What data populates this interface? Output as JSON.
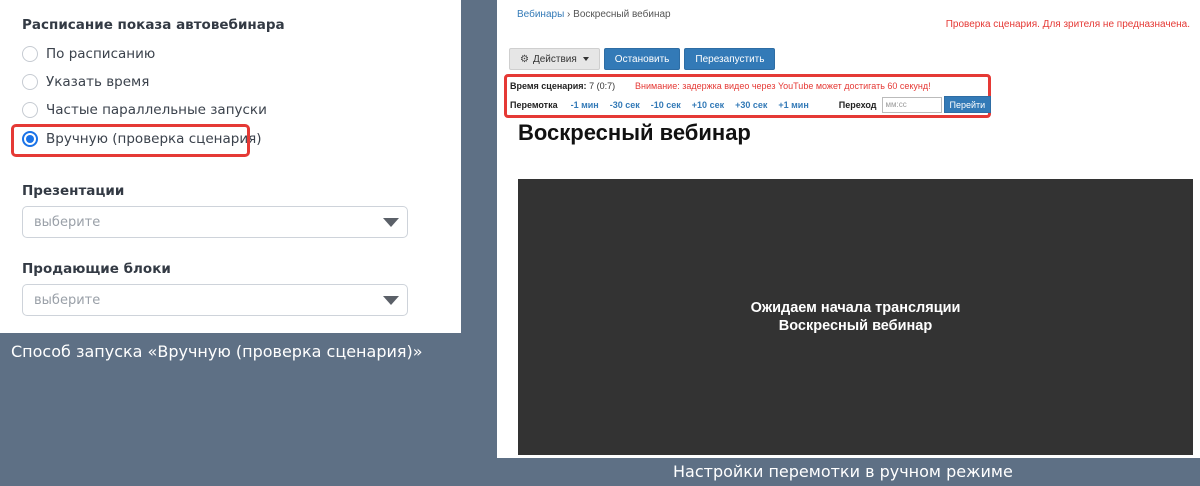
{
  "left": {
    "schedule_heading": "Расписание показа автовебинара",
    "radio_options": [
      {
        "label": "По расписанию",
        "checked": false
      },
      {
        "label": "Указать время",
        "checked": false
      },
      {
        "label": "Частые параллельные запуски",
        "checked": false
      },
      {
        "label": "Вручную (проверка сценария)",
        "checked": true
      }
    ],
    "presentations_heading": "Презентации",
    "presentations_placeholder": "выберите",
    "selling_blocks_heading": "Продающие блоки",
    "selling_blocks_placeholder": "выберите",
    "caption": "Способ запуска «Вручную (проверка сценария)»"
  },
  "right": {
    "breadcrumb": {
      "link": "Вебинары",
      "separator": "›",
      "current": "Воскресный вебинар"
    },
    "preview_note": "Проверка сценария. Для зрителя не предназначена.",
    "buttons": {
      "actions": "Действия",
      "stop": "Остановить",
      "restart": "Перезапустить"
    },
    "scenario_time_label": "Время сценария:",
    "scenario_time_value": "7 (0:7)",
    "youtube_warning": "Внимание: задержка видео через YouTube может достигать 60 секунд!",
    "rewind_label": "Перемотка",
    "rewind_options": [
      "-1 мин",
      "-30 сек",
      "-10 сек",
      "+10 сек",
      "+30 сек",
      "+1 мин"
    ],
    "jump_label": "Переход",
    "jump_placeholder": "мм:сс",
    "jump_button": "Перейти",
    "page_title": "Воскресный вебинар",
    "player_line1": "Ожидаем начала трансляции",
    "player_line2": "Воскресный вебинар",
    "caption": "Настройки перемотки в ручном режиме"
  },
  "colors": {
    "background": "#5e7085",
    "highlight": "#e53935",
    "radio_accent": "#1a73e8",
    "primary_button": "#337ab7",
    "player_bg": "#333333"
  }
}
